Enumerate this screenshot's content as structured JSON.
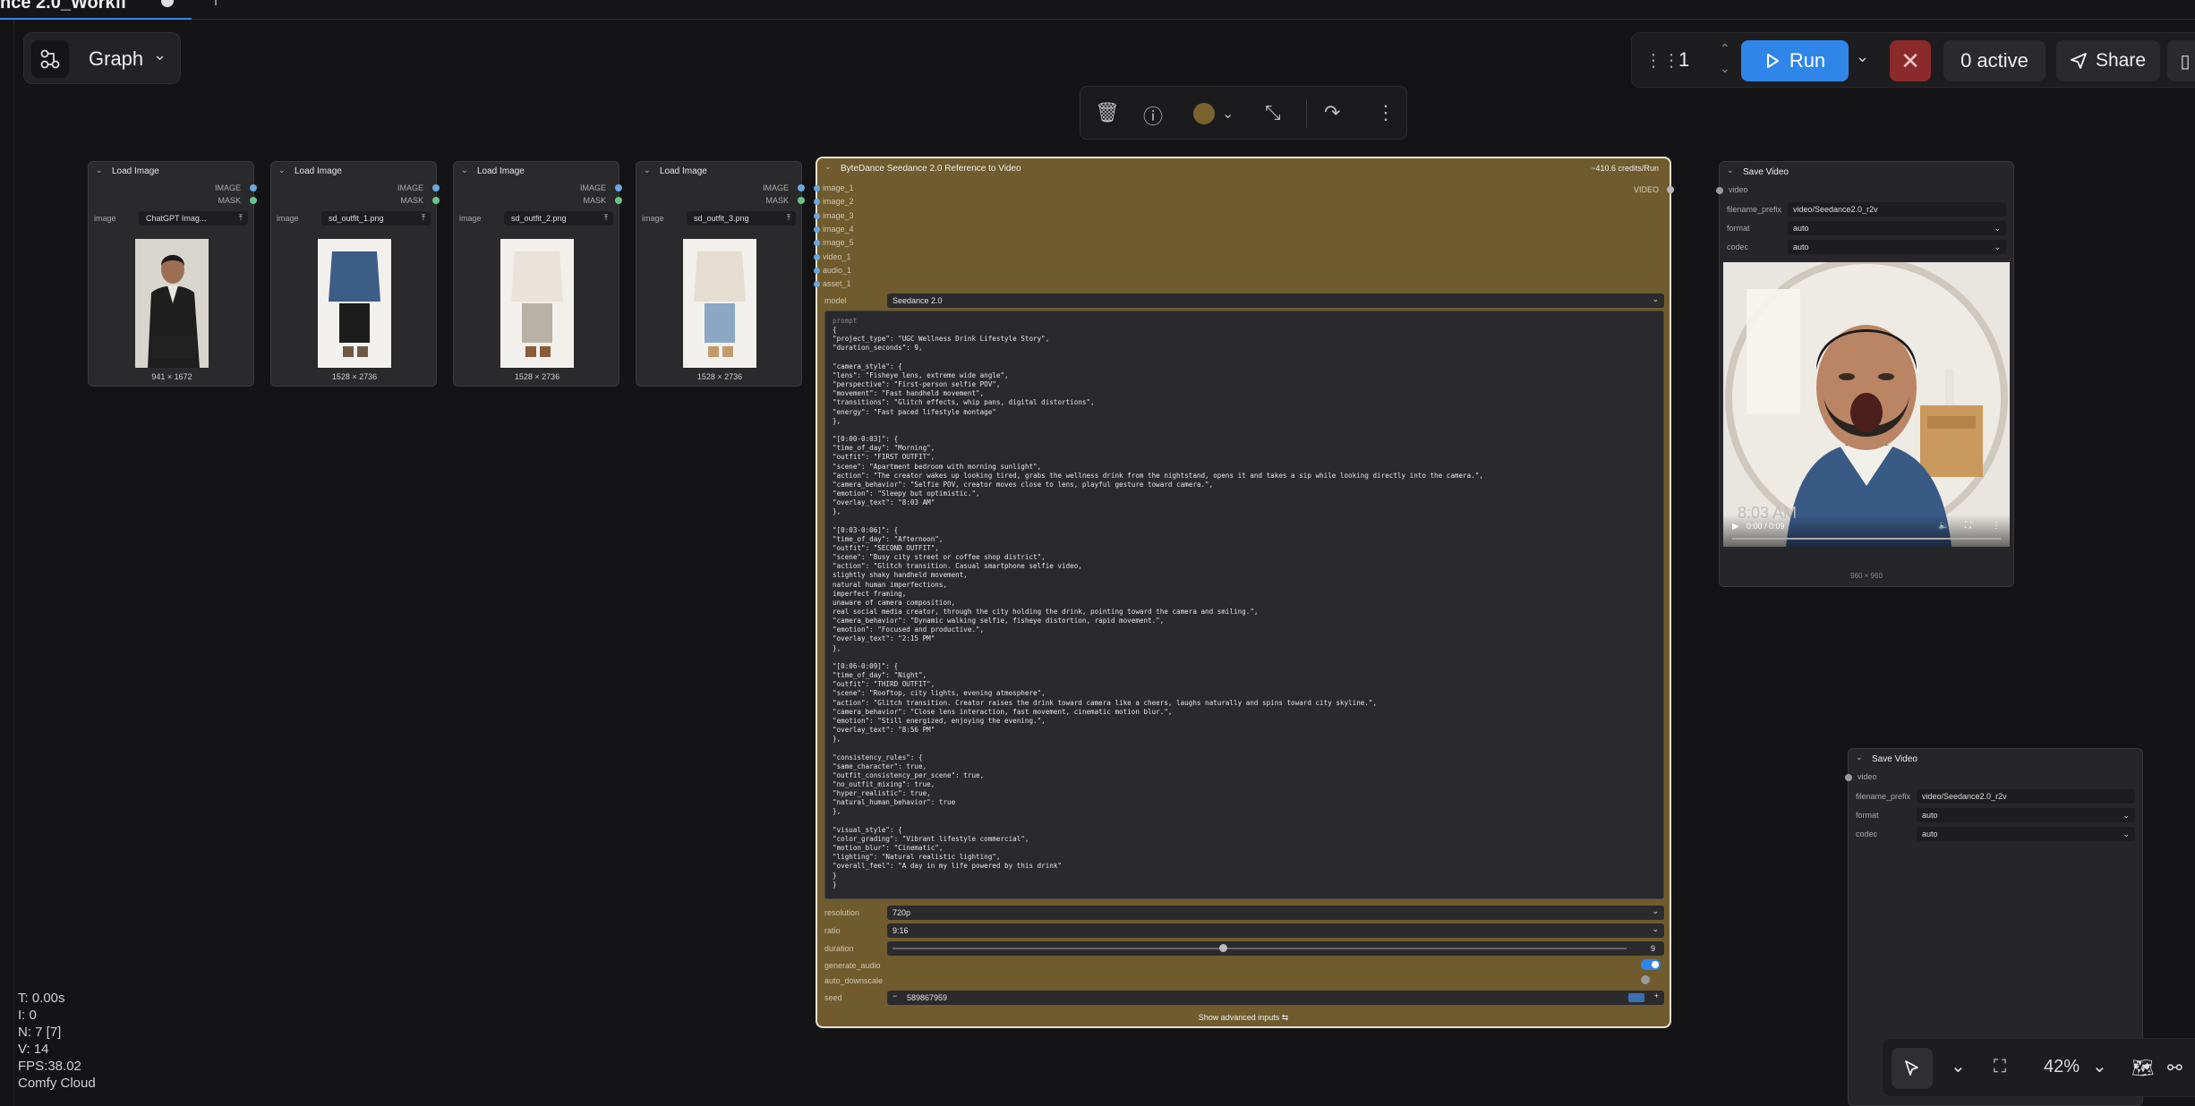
{
  "tab": {
    "title": "nce 2.0_Workfl",
    "dirty": "●"
  },
  "graph_button": {
    "label": "Graph"
  },
  "runbar": {
    "count": "1",
    "run_label": "Run",
    "active_label": "0 active",
    "share_label": "Share"
  },
  "toolbar": {
    "items": [
      "delete-icon",
      "info-icon",
      "color-icon",
      "collapse-icon",
      "bypass-icon",
      "more-icon"
    ]
  },
  "load_nodes": [
    {
      "title": "Load Image",
      "out1": "IMAGE",
      "out2": "MASK",
      "widget_label": "image",
      "file": "ChatGPT Imag...",
      "size": "941 × 1672"
    },
    {
      "title": "Load Image",
      "out1": "IMAGE",
      "out2": "MASK",
      "widget_label": "image",
      "file": "sd_outfit_1.png",
      "size": "1528 × 2736"
    },
    {
      "title": "Load Image",
      "out1": "IMAGE",
      "out2": "MASK",
      "widget_label": "image",
      "file": "sd_outfit_2.png",
      "size": "1528 × 2736"
    },
    {
      "title": "Load Image",
      "out1": "IMAGE",
      "out2": "MASK",
      "widget_label": "image",
      "file": "sd_outfit_3.png",
      "size": "1528 × 2736"
    }
  ],
  "seedance": {
    "title": "ByteDance Seedance 2.0 Reference to Video",
    "credits": "~410.6 credits/Run",
    "output": "VIDEO",
    "inputs": [
      "image_1",
      "image_2",
      "image_3",
      "image_4",
      "image_5",
      "video_1",
      "audio_1",
      "asset_1"
    ],
    "model_label": "model",
    "model_value": "Seedance 2.0",
    "prompt_label": "prompt",
    "prompt": "{\n\"project_type\": \"UGC Wellness Drink Lifestyle Story\",\n\"duration_seconds\": 9,\n\n\"camera_style\": {\n\"lens\": \"Fisheye lens, extreme wide angle\",\n\"perspective\": \"First-person selfie POV\",\n\"movement\": \"Fast handheld movement\",\n\"transitions\": \"Glitch effects, whip pans, digital distortions\",\n\"energy\": \"Fast paced lifestyle montage\"\n},\n\n\"[0:00-0:03]\": {\n\"time_of_day\": \"Morning\",\n\"outfit\": \"FIRST OUTFIT\",\n\"scene\": \"Apartment bedroom with morning sunlight\",\n\"action\": \"The creator wakes up looking tired, grabs the wellness drink from the nightstand, opens it and takes a sip while looking directly into the camera.\",\n\"camera_behavior\": \"Selfie POV, creator moves close to lens, playful gesture toward camera.\",\n\"emotion\": \"Sleepy but optimistic.\",\n\"overlay_text\": \"8:03 AM\"\n},\n\n\"[0:03-0:06]\": {\n\"time_of_day\": \"Afternoon\",\n\"outfit\": \"SECOND OUTFIT\",\n\"scene\": \"Busy city street or coffee shop district\",\n\"action\": \"Glitch transition. Casual smartphone selfie video,\nslightly shaky handheld movement,\nnatural human imperfections,\nimperfect framing,\nunaware of camera composition,\nreal social media creator, through the city holding the drink, pointing toward the camera and smiling.\",\n\"camera_behavior\": \"Dynamic walking selfie, fisheye distortion, rapid movement.\",\n\"emotion\": \"Focused and productive.\",\n\"overlay_text\": \"2:15 PM\"\n},\n\n\"[0:06-0:09]\": {\n\"time_of_day\": \"Night\",\n\"outfit\": \"THIRD OUTFIT\",\n\"scene\": \"Rooftop, city lights, evening atmosphere\",\n\"action\": \"Glitch transition. Creator raises the drink toward camera like a cheers, laughs naturally and spins toward city skyline.\",\n\"camera_behavior\": \"Close lens interaction, fast movement, cinematic motion blur.\",\n\"emotion\": \"Still energized, enjoying the evening.\",\n\"overlay_text\": \"8:56 PM\"\n},\n\n\"consistency_rules\": {\n\"same_character\": true,\n\"outfit_consistency_per_scene\": true,\n\"no_outfit_mixing\": true,\n\"hyper_realistic\": true,\n\"natural_human_behavior\": true\n},\n\n\"visual_style\": {\n\"color_grading\": \"Vibrant lifestyle commercial\",\n\"motion_blur\": \"Cinematic\",\n\"lighting\": \"Natural realistic lighting\",\n\"overall_feel\": \"A day in my life powered by this drink\"\n}\n}",
    "resolution_label": "resolution",
    "resolution_value": "720p",
    "ratio_label": "ratio",
    "ratio_value": "9:16",
    "duration_label": "duration",
    "duration_value": "9",
    "duration_fraction": 0.45,
    "generate_audio_label": "generate_audio",
    "auto_downscale_label": "auto_downscale",
    "seed_label": "seed",
    "seed_value": "589867959",
    "show_advanced": "Show advanced inputs"
  },
  "save_video_1": {
    "title": "Save Video",
    "input": "video",
    "filename_label": "filename_prefix",
    "filename_value": "video/Seedance2.0_r2v",
    "format_label": "format",
    "format_value": "auto",
    "codec_label": "codec",
    "codec_value": "auto",
    "overlay_time": "8:03 AM",
    "player_time": "0:00 / 0:09",
    "caption": "960 × 960"
  },
  "save_video_2": {
    "title": "Save Video",
    "input": "video",
    "filename_label": "filename_prefix",
    "filename_value": "video/Seedance2.0_r2v",
    "format_label": "format",
    "format_value": "auto",
    "codec_label": "codec",
    "codec_value": "auto"
  },
  "stats": {
    "t": "T: 0.00s",
    "i": "I: 0",
    "n": "N: 7 [7]",
    "v": "V: 14",
    "fps": "FPS:38.02",
    "brand": "Comfy Cloud"
  },
  "zoom": {
    "level": "42%"
  },
  "colors": {
    "accent": "#2f86e8",
    "node_highlight": "#6f5b2e",
    "cancel": "#8a2a2a"
  }
}
